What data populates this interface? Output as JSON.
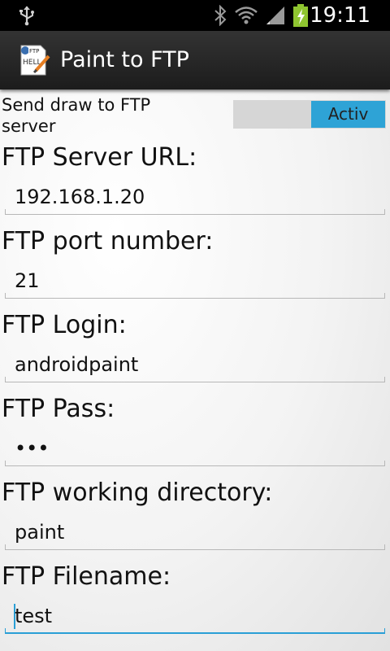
{
  "status_bar": {
    "time": "19:11",
    "icons": [
      "usb-icon",
      "bluetooth-icon",
      "wifi-icon",
      "signal-icon",
      "battery-charging-icon"
    ]
  },
  "action_bar": {
    "title": "Paint to FTP",
    "app_icon": "paint-app-icon"
  },
  "toggle": {
    "label": "Send draw to FTP server",
    "state_label": "Activ",
    "on": true,
    "accent": "#2ea3d6"
  },
  "fields": [
    {
      "label": "FTP Server URL:",
      "value": "192.168.1.20"
    },
    {
      "label": "FTP port number:",
      "value": "21"
    },
    {
      "label": "FTP Login:",
      "value": "androidpaint"
    },
    {
      "label": "FTP Pass:",
      "value": "•••"
    },
    {
      "label": "FTP working directory:",
      "value": "paint"
    },
    {
      "label": "FTP Filename:",
      "value": "test",
      "focused": true
    }
  ]
}
